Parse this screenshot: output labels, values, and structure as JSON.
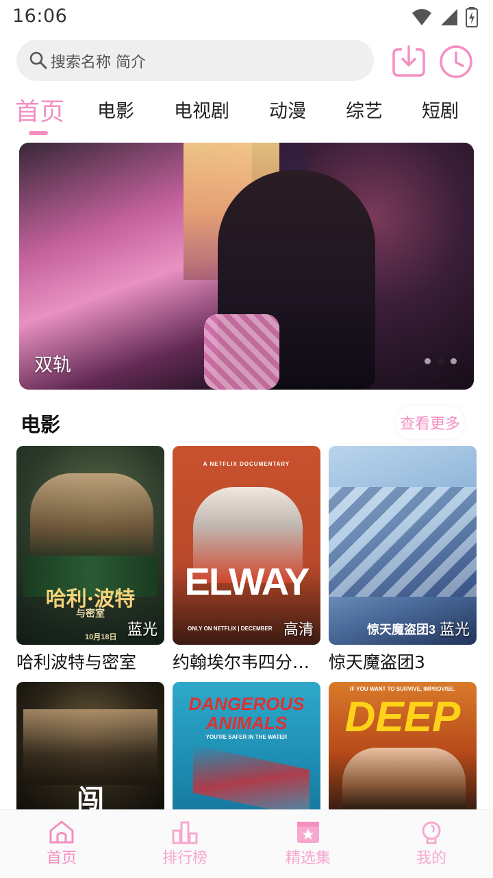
{
  "status_bar": {
    "time": "16:06"
  },
  "search": {
    "placeholder": "搜索名称 简介"
  },
  "tabs": [
    {
      "label": "首页",
      "active": true
    },
    {
      "label": "电影"
    },
    {
      "label": "电视剧"
    },
    {
      "label": "动漫"
    },
    {
      "label": "综艺"
    },
    {
      "label": "短剧"
    }
  ],
  "banner": {
    "title": "双轨",
    "slide_count": 3,
    "active_slide": 1
  },
  "section": {
    "title": "电影",
    "more_label": "查看更多"
  },
  "movies": [
    {
      "title": "哈利波特与密室",
      "badge": "蓝光",
      "poster_text": "哈利·波特",
      "poster_subtext": "与密室",
      "poster_date": "10月18日"
    },
    {
      "title": "约翰埃尔韦四分卫传奇",
      "badge": "高清",
      "poster_text": "ELWAY",
      "poster_topline": "A NETFLIX DOCUMENTARY",
      "poster_bottom": "ONLY ON NETFLIX | DECEMBER"
    },
    {
      "title": "惊天魔盗团3",
      "badge": "蓝光",
      "poster_text": "惊天魔盗团3"
    },
    {
      "title": "",
      "badge": "",
      "poster_text": "闯"
    },
    {
      "title": "",
      "badge": "",
      "poster_text": "DANGEROUS ANIMALS",
      "poster_subtext": "YOU'RE SAFER IN THE WATER"
    },
    {
      "title": "",
      "badge": "",
      "poster_text": "DEEP",
      "poster_topline": "IF YOU WANT TO SURVIVE, IMPROVISE."
    }
  ],
  "bottom_nav": [
    {
      "label": "首页",
      "icon": "home-icon",
      "active": true
    },
    {
      "label": "排行榜",
      "icon": "ranking-icon"
    },
    {
      "label": "精选集",
      "icon": "collection-icon"
    },
    {
      "label": "我的",
      "icon": "profile-icon"
    }
  ],
  "colors": {
    "accent": "#f48fc1",
    "accent_light": "#f7a8cf"
  }
}
